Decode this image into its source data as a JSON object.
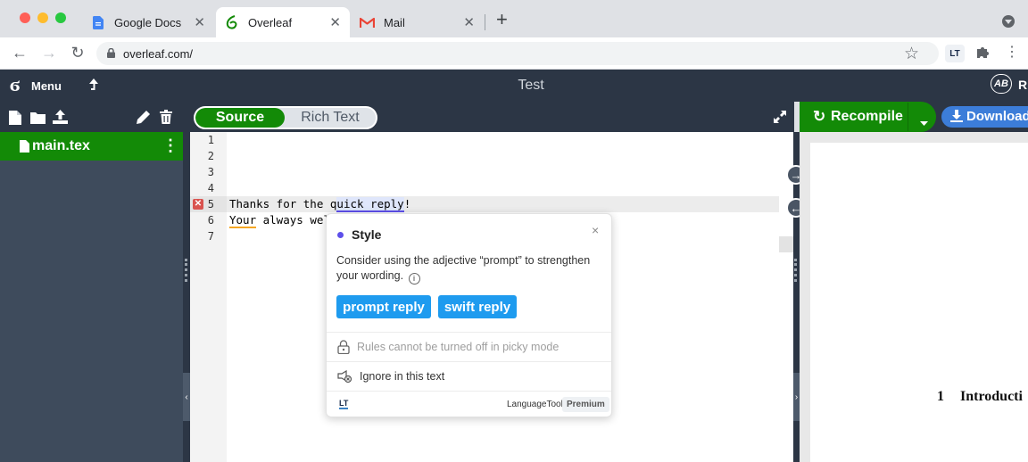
{
  "browser": {
    "tabs": [
      {
        "title": "Google Docs",
        "icon": "google-docs-icon"
      },
      {
        "title": "Overleaf",
        "icon": "overleaf-icon"
      },
      {
        "title": "Mail",
        "icon": "gmail-icon"
      }
    ],
    "url": "overleaf.com/",
    "colors": {
      "close": "#ff5f57",
      "minimize": "#febc2e",
      "maximize": "#28c840"
    }
  },
  "overleaf": {
    "menu_label": "Menu",
    "project_title": "Test",
    "file_name": "main.tex",
    "source_label": "Source",
    "rich_text_label": "Rich Text",
    "recompile_label": "Recompile",
    "download_label": "Download",
    "review_partial": "R",
    "accent": "#138a07",
    "download_color": "#3c7dd9"
  },
  "editor": {
    "line_numbers": [
      "1",
      "2",
      "3",
      "4",
      "5",
      "6",
      "7"
    ],
    "error_line": "5",
    "line5_pre": "Thanks for the q",
    "line5_cursor_rest": "uick reply",
    "line5_end": "!",
    "line6_word": "Your",
    "line6_rest": " always wel"
  },
  "popup": {
    "category": "Style",
    "message": "Consider using the adjective “prompt” to strengthen your wording.",
    "suggestions": [
      "prompt reply",
      "swift reply"
    ],
    "rules_note": "Rules cannot be turned off in picky mode",
    "ignore_label": "Ignore in this text",
    "brand": "LanguageTool",
    "premium_badge": "Premium",
    "dot_color": "#5d4fea"
  },
  "pdf": {
    "section_number": "1",
    "section_title": "Introducti"
  }
}
